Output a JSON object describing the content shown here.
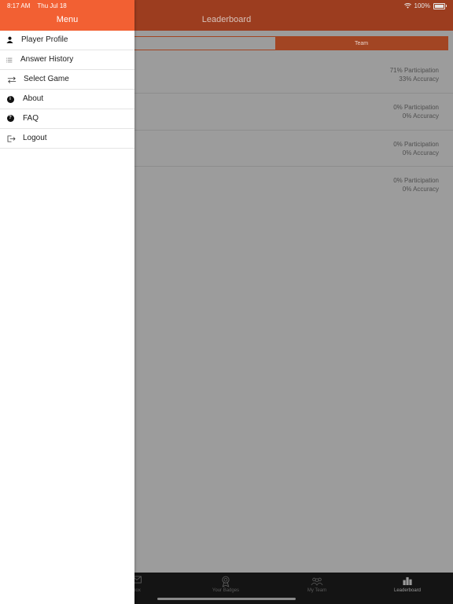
{
  "status": {
    "time": "8:17 AM",
    "date": "Thu Jul 18",
    "battery": "100%"
  },
  "app": {
    "title": "Leaderboard",
    "segments": [
      {
        "label": ""
      },
      {
        "label": "Team",
        "active": true
      }
    ],
    "rows": [
      {
        "participation": "71% Participation",
        "accuracy": "33% Accuracy"
      },
      {
        "participation": "0% Participation",
        "accuracy": "0% Accuracy"
      },
      {
        "participation": "0% Participation",
        "accuracy": "0% Accuracy"
      },
      {
        "participation": "0% Participation",
        "accuracy": "0% Accuracy"
      }
    ],
    "tabs": [
      {
        "label": "box",
        "icon": "envelope-icon"
      },
      {
        "label": "Your Badges",
        "icon": "badge-icon"
      },
      {
        "label": "My Team",
        "icon": "team-icon"
      },
      {
        "label": "Leaderboard",
        "icon": "bar-chart-icon",
        "active": true
      }
    ]
  },
  "menu": {
    "title": "Menu",
    "items": [
      {
        "label": "Player Profile",
        "icon": "person-icon"
      },
      {
        "label": "Answer History",
        "icon": "list-icon"
      },
      {
        "label": "Select Game",
        "icon": "swap-arrows-icon"
      },
      {
        "label": "About",
        "icon": "info-icon"
      },
      {
        "label": "FAQ",
        "icon": "help-icon"
      },
      {
        "label": "Logout",
        "icon": "logout-icon"
      }
    ]
  },
  "colors": {
    "accent": "#f26033",
    "accent_dimmed": "#9c3d1f",
    "overlay": "#9c9c9c"
  }
}
